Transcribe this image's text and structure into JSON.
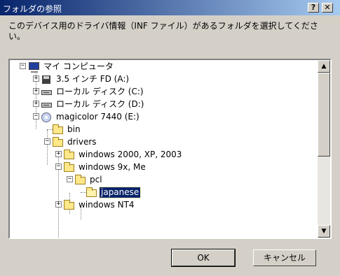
{
  "window": {
    "title": "フォルダの参照",
    "help_button": "?",
    "close_button": "✕"
  },
  "description": "このデバイス用のドライバ情報（INF ファイル）があるフォルダを選択してください。",
  "tree": {
    "items": [
      {
        "label": "マイ コンピュータ",
        "icon": "computer-icon",
        "expander": "−"
      },
      {
        "label": "3.5 インチ FD (A:)",
        "icon": "floppy-drive-icon",
        "expander": "+"
      },
      {
        "label": "ローカル ディスク (C:)",
        "icon": "hard-drive-icon",
        "expander": "+"
      },
      {
        "label": "ローカル ディスク (D:)",
        "icon": "hard-drive-icon",
        "expander": "+"
      },
      {
        "label": "magicolor 7440 (E:)",
        "icon": "cd-drive-icon",
        "expander": "−"
      },
      {
        "label": "bin",
        "icon": "folder-icon",
        "expander": ""
      },
      {
        "label": "drivers",
        "icon": "folder-icon",
        "expander": "−"
      },
      {
        "label": "windows 2000, XP, 2003",
        "icon": "folder-icon",
        "expander": "+"
      },
      {
        "label": "windows 9x, Me",
        "icon": "folder-icon",
        "expander": "−"
      },
      {
        "label": "pcl",
        "icon": "folder-icon",
        "expander": "−"
      },
      {
        "label": "japanese",
        "icon": "open-folder-icon",
        "expander": "",
        "selected": true
      },
      {
        "label": "windows NT4",
        "icon": "folder-icon",
        "expander": "+"
      }
    ]
  },
  "scrollbar": {
    "up_arrow": "▲",
    "down_arrow": "▼"
  },
  "buttons": {
    "ok": "OK",
    "cancel": "キャンセル"
  }
}
